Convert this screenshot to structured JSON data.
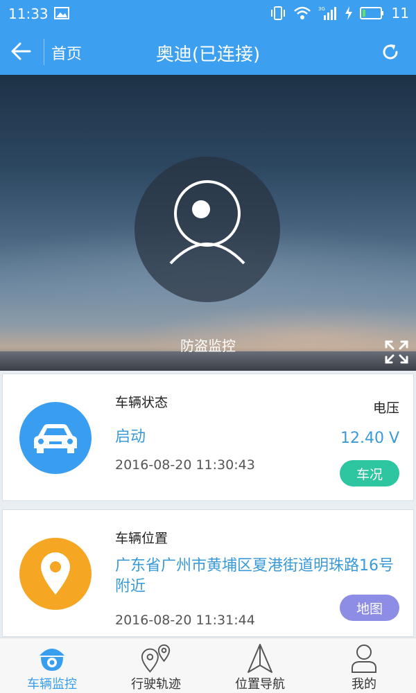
{
  "status_bar": {
    "time": "11:33",
    "battery_level": "11",
    "icons": [
      "image-icon",
      "vibrate-icon",
      "wifi-icon",
      "signal-3g-icon",
      "charging-icon",
      "battery-icon"
    ]
  },
  "header": {
    "back_icon": "back-arrow-icon",
    "home_label": "首页",
    "title": "奥迪(已连接)",
    "refresh_icon": "refresh-icon"
  },
  "hero": {
    "label": "防盗监控",
    "camera_icon": "camera-icon",
    "fullscreen_icon": "fullscreen-icon"
  },
  "vehicle_status": {
    "title": "车辆状态",
    "state": "启动",
    "timestamp": "2016-08-20 11:30:43",
    "voltage_label": "电压",
    "voltage_value": "12.40 V",
    "button_label": "车况",
    "icon": "car-icon"
  },
  "vehicle_location": {
    "title": "车辆位置",
    "address": "广东省广州市黄埔区夏港街道明珠路16号附近",
    "timestamp": "2016-08-20 11:31:44",
    "button_label": "地图",
    "icon": "location-pin-icon"
  },
  "bottom_nav": {
    "items": [
      {
        "label": "车辆监控",
        "icon": "camera-dome-icon",
        "active": true
      },
      {
        "label": "行驶轨迹",
        "icon": "route-icon",
        "active": false
      },
      {
        "label": "位置导航",
        "icon": "navigation-icon",
        "active": false
      },
      {
        "label": "我的",
        "icon": "user-icon",
        "active": false
      }
    ]
  },
  "colors": {
    "primary": "#3c9ff0",
    "accent_text": "#3a9ad8",
    "green": "#2ec6a0",
    "purple": "#8d8de6",
    "orange": "#f5a623"
  }
}
